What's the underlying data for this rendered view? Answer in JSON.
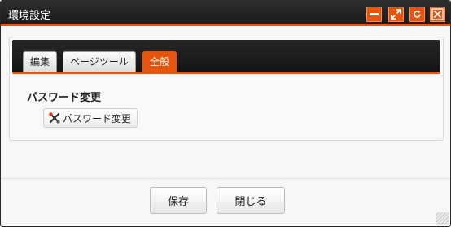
{
  "window": {
    "title": "環境設定",
    "controls": [
      "minimize-icon",
      "maximize-icon",
      "refresh-icon",
      "close-icon"
    ]
  },
  "tabs": [
    {
      "label": "編集",
      "active": false
    },
    {
      "label": "ページツール",
      "active": false
    },
    {
      "label": "全般",
      "active": true
    }
  ],
  "section": {
    "title": "パスワード変更",
    "button_label": "パスワード変更",
    "button_icon": "tools-icon"
  },
  "footer": {
    "save_label": "保存",
    "close_label": "閉じる"
  },
  "colors": {
    "accent": "#e8540e",
    "titlebar": "#1b1b1b"
  }
}
